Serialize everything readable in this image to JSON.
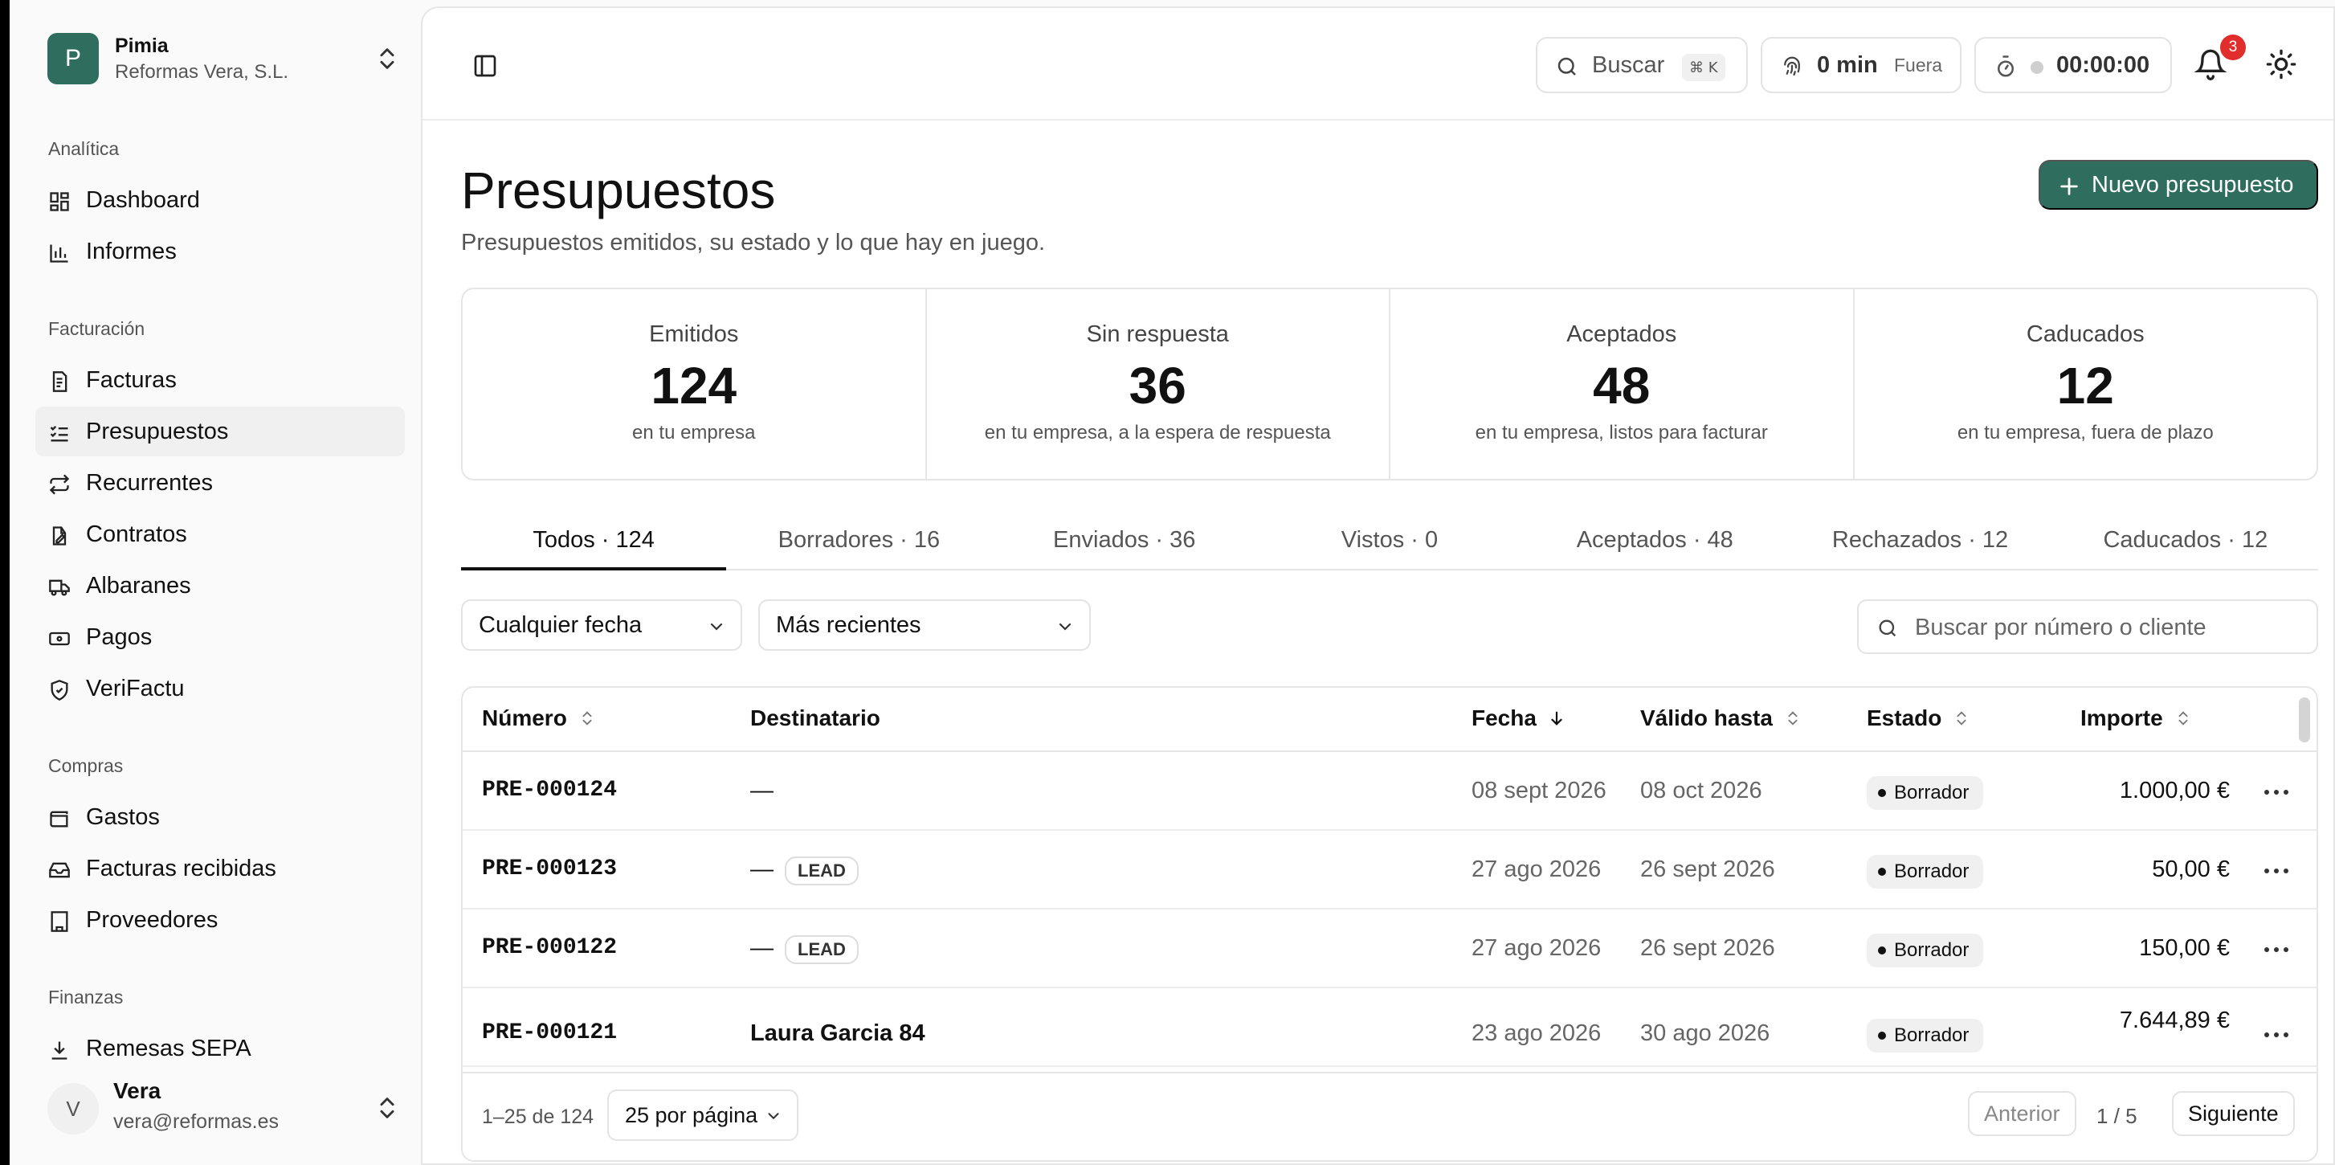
{
  "org": {
    "initial": "P",
    "name": "Pimia",
    "company": "Reformas Vera, S.L."
  },
  "sidebar": {
    "sections": [
      {
        "title": "Analítica",
        "items": [
          {
            "label": "Dashboard",
            "icon": "dashboard-icon"
          },
          {
            "label": "Informes",
            "icon": "bar-chart-icon"
          }
        ]
      },
      {
        "title": "Facturación",
        "items": [
          {
            "label": "Facturas",
            "icon": "document-icon"
          },
          {
            "label": "Presupuestos",
            "icon": "list-check-icon",
            "active": true
          },
          {
            "label": "Recurrentes",
            "icon": "repeat-icon"
          },
          {
            "label": "Contratos",
            "icon": "contract-icon"
          },
          {
            "label": "Albaranes",
            "icon": "truck-icon"
          },
          {
            "label": "Pagos",
            "icon": "banknote-icon"
          },
          {
            "label": "VeriFactu",
            "icon": "shield-check-icon"
          }
        ]
      },
      {
        "title": "Compras",
        "items": [
          {
            "label": "Gastos",
            "icon": "wallet-icon"
          },
          {
            "label": "Facturas recibidas",
            "icon": "inbox-icon"
          },
          {
            "label": "Proveedores",
            "icon": "building-icon"
          }
        ]
      },
      {
        "title": "Finanzas",
        "items": [
          {
            "label": "Remesas SEPA",
            "icon": "download-icon"
          }
        ]
      }
    ]
  },
  "user": {
    "initial": "V",
    "name": "Vera",
    "email": "vera@reformas.es"
  },
  "topbar": {
    "search_label": "Buscar",
    "search_shortcut": "⌘ K",
    "clock_value": "0 min",
    "clock_status": "Fuera",
    "timer_value": "00:00:00",
    "notifications_count": "3"
  },
  "page": {
    "title": "Presupuestos",
    "subtitle": "Presupuestos emitidos, su estado y lo que hay en juego.",
    "new_button": "Nuevo presupuesto"
  },
  "stats": [
    {
      "title": "Emitidos",
      "value": "124",
      "sub": "en tu empresa"
    },
    {
      "title": "Sin respuesta",
      "value": "36",
      "sub": "en tu empresa, a la espera de respuesta"
    },
    {
      "title": "Aceptados",
      "value": "48",
      "sub": "en tu empresa, listos para facturar"
    },
    {
      "title": "Caducados",
      "value": "12",
      "sub": "en tu empresa, fuera de plazo"
    }
  ],
  "tabs": [
    {
      "label": "Todos · 124",
      "active": true
    },
    {
      "label": "Borradores · 16"
    },
    {
      "label": "Enviados · 36"
    },
    {
      "label": "Vistos · 0"
    },
    {
      "label": "Aceptados · 48"
    },
    {
      "label": "Rechazados · 12"
    },
    {
      "label": "Caducados · 12"
    }
  ],
  "filters": {
    "date": "Cualquier fecha",
    "sort": "Más recientes",
    "search_placeholder": "Buscar por número o cliente"
  },
  "table": {
    "headers": {
      "number": "Número",
      "recipient": "Destinatario",
      "date": "Fecha",
      "valid": "Válido hasta",
      "status": "Estado",
      "amount": "Importe"
    },
    "rows": [
      {
        "number": "PRE-000124",
        "recipient": "—",
        "lead": "",
        "date": "08 sept 2026",
        "valid": "08 oct 2026",
        "status": "Borrador",
        "amount": "1.000,00 €"
      },
      {
        "number": "PRE-000123",
        "recipient": "—",
        "lead": "LEAD",
        "date": "27 ago 2026",
        "valid": "26 sept 2026",
        "status": "Borrador",
        "amount": "50,00 €"
      },
      {
        "number": "PRE-000122",
        "recipient": "—",
        "lead": "LEAD",
        "date": "27 ago 2026",
        "valid": "26 sept 2026",
        "status": "Borrador",
        "amount": "150,00 €"
      },
      {
        "number": "PRE-000121",
        "recipient": "Laura Garcia 84",
        "lead": "",
        "date": "23 ago 2026",
        "valid": "30 ago 2026",
        "status": "Borrador",
        "amount": "7.644,89 €"
      }
    ]
  },
  "pagination": {
    "range": "1–25 de 124",
    "per_page": "25 por página",
    "prev": "Anterior",
    "page": "1 / 5",
    "next": "Siguiente"
  }
}
